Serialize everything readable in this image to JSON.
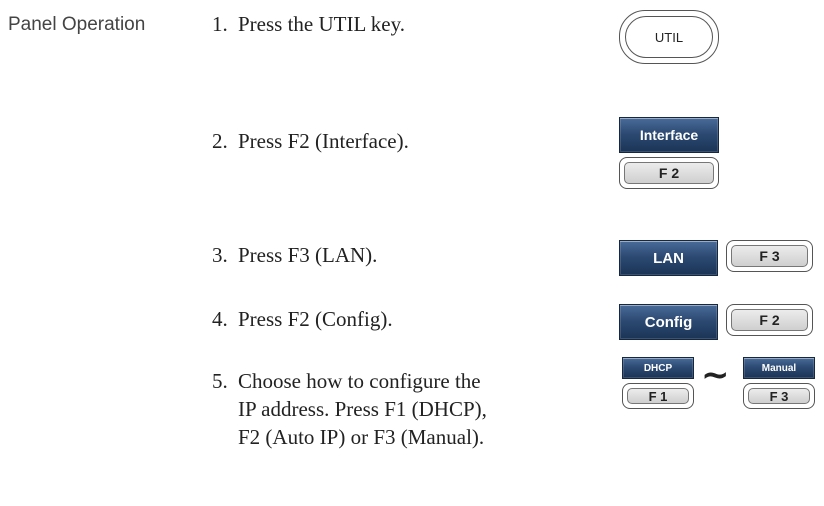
{
  "section_label": "Panel Operation",
  "steps": [
    {
      "num": "1.",
      "lines": [
        "Press the UTIL key."
      ]
    },
    {
      "num": "2.",
      "lines": [
        "Press F2 (Interface)."
      ]
    },
    {
      "num": "3.",
      "lines": [
        "Press F3 (LAN)."
      ]
    },
    {
      "num": "4.",
      "lines": [
        "Press F2 (Config)."
      ]
    },
    {
      "num": "5.",
      "lines": [
        "Choose how to configure the",
        "IP address. Press F1 (DHCP),",
        "F2 (Auto IP) or F3 (Manual)."
      ]
    }
  ],
  "keys": {
    "util": "UTIL",
    "interface_soft": "Interface",
    "f2_a": "F 2",
    "lan_soft": "LAN",
    "f3_a": "F 3",
    "config_soft": "Config",
    "f2_b": "F 2",
    "dhcp_soft": "DHCP",
    "f1": "F 1",
    "manual_soft": "Manual",
    "f3_b": "F 3",
    "separator": "~"
  },
  "colors": {
    "soft_key_top": "#4a6c99",
    "soft_key_bottom": "#1b3456",
    "function_key_face": "#dcdcdc"
  }
}
